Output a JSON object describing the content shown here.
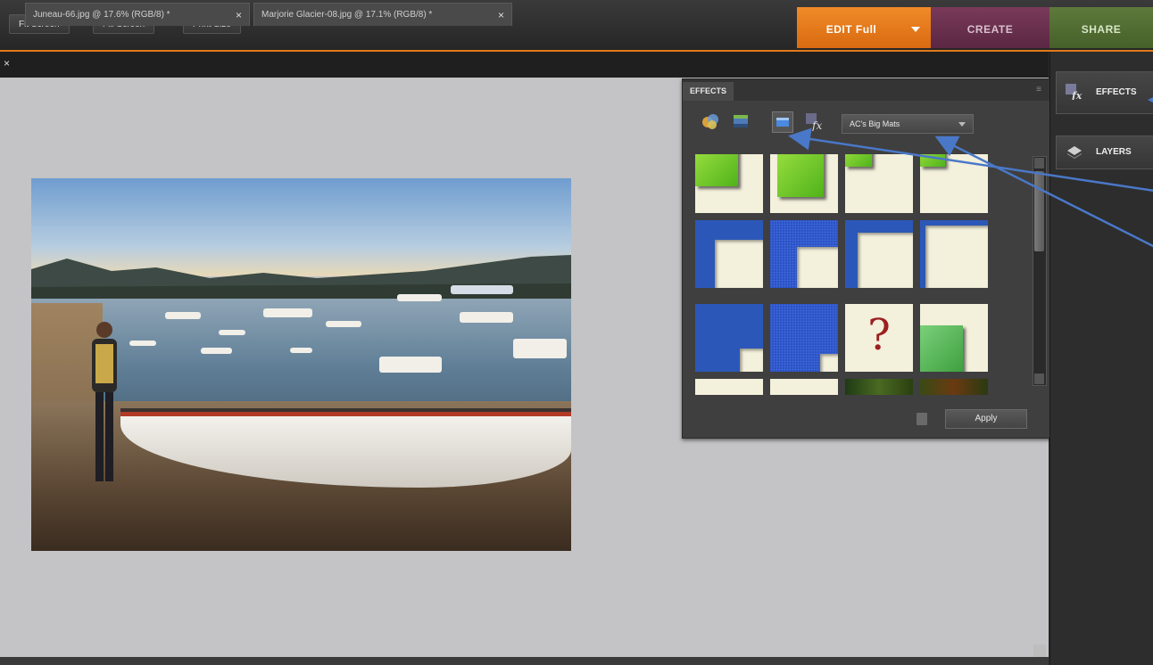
{
  "toolbar": {
    "fit_screen": "Fit Screen",
    "fill_screen": "Fill Screen",
    "print_size": "Print Size"
  },
  "modes": {
    "edit": "EDIT Full",
    "create": "CREATE",
    "share": "SHARE"
  },
  "doc_tabs": [
    {
      "label": "Juneau-66.jpg @ 17.6% (RGB/8) *"
    },
    {
      "label": "Marjorie Glacier-08.jpg @ 17.1% (RGB/8) *"
    }
  ],
  "effects_panel": {
    "tab_label": "EFFECTS",
    "menu_glyph": "≡",
    "dropdown_value": "AC's Big Mats",
    "apply_label": "Apply",
    "filter_icons": [
      "filters-icon",
      "layer-styles-icon",
      "photo-effects-icon",
      "all-effects-icon"
    ]
  },
  "dock": {
    "effects_label": "EFFECTS",
    "layers_label": "LAYERS"
  },
  "thumbnail_glyph": "?",
  "colors": {
    "edit_accent": "#e07a1a",
    "create": "#6b3050",
    "share": "#527033",
    "annotation_arrow": "#4a78c8"
  }
}
